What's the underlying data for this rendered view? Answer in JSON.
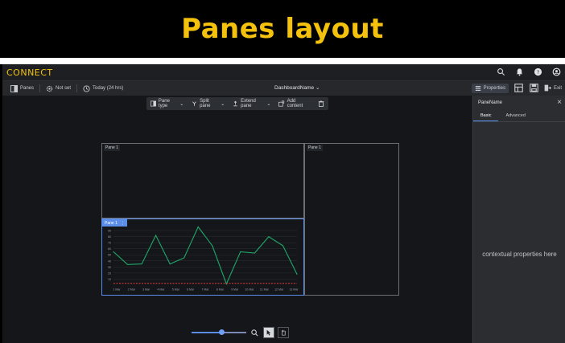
{
  "banner": {
    "title": "Panes layout"
  },
  "app": {
    "logo": "CONNECT",
    "top_icons": [
      "search-icon",
      "bell-icon",
      "help-icon",
      "user-icon"
    ]
  },
  "subbar": {
    "panes_label": "Panes",
    "not_set_label": "Not set",
    "time_label": "Today (24 hrs)",
    "dashboard_name": "DashboardName",
    "properties_label": "Properties",
    "exit_label": "Exit"
  },
  "toolbar": {
    "pane_type": "Pane type",
    "split_pane": "Split pane",
    "extend_pane": "Extend pane",
    "add_content": "Add content"
  },
  "panes": [
    {
      "label": "Pane 1"
    },
    {
      "label": "Pane 1"
    },
    {
      "label": "Pane 1"
    }
  ],
  "chart_data": {
    "type": "line",
    "categories": [
      "1 Mar",
      "2 Mar",
      "3 Mar",
      "4 Mar",
      "5 Mar",
      "6 Mar",
      "7 Mar",
      "8 Mar",
      "9 Mar",
      "10 Mar",
      "11 Mar",
      "12 Mar",
      "13 Mar"
    ],
    "y_ticks": [
      "90",
      "80",
      "70",
      "60",
      "50",
      "40",
      "30",
      "20",
      "10"
    ],
    "ylim": [
      0,
      90
    ],
    "series": [
      {
        "values": [
          55,
          34,
          35,
          82,
          35,
          45,
          96,
          65,
          2,
          55,
          53,
          80,
          65,
          18
        ],
        "color": "#1fa86a"
      },
      {
        "values": [
          3,
          3,
          3,
          3,
          3,
          3,
          3,
          3,
          3,
          3,
          3,
          3,
          3,
          3
        ],
        "color": "#e23b3b",
        "dashed": true
      }
    ]
  },
  "properties": {
    "title": "PaneName",
    "tabs": [
      "Basic",
      "Advanced"
    ],
    "body": "contextual properties here"
  },
  "zoom": {
    "level": 0.55
  }
}
